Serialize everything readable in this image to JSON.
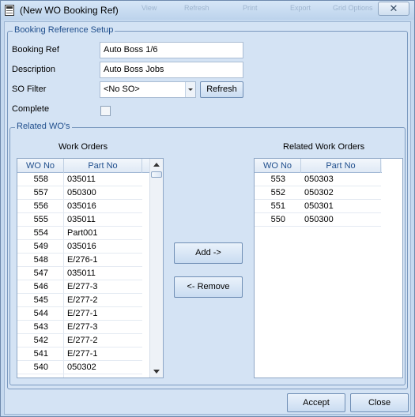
{
  "window": {
    "title": "(New WO Booking Ref)",
    "close_label": "✕",
    "background_toolbar": [
      "View",
      "Refresh",
      "Print",
      "Export",
      "Grid Options"
    ]
  },
  "booking": {
    "legend": "Booking Reference Setup",
    "ref_label": "Booking Ref",
    "ref_value": "Auto Boss 1/6",
    "desc_label": "Description",
    "desc_value": "Auto Boss Jobs",
    "so_label": "SO Filter",
    "so_value": "<No SO>",
    "refresh_label": "Refresh",
    "complete_label": "Complete",
    "complete_checked": false
  },
  "related": {
    "legend": "Related WO's",
    "left_caption": "Work Orders",
    "right_caption": "Related Work Orders",
    "columns": [
      "WO No",
      "Part No"
    ],
    "work_orders": [
      [
        "558",
        "035011"
      ],
      [
        "557",
        "050300"
      ],
      [
        "556",
        "035016"
      ],
      [
        "555",
        "035011"
      ],
      [
        "554",
        "Part001"
      ],
      [
        "549",
        "035016"
      ],
      [
        "548",
        "E/276-1"
      ],
      [
        "547",
        "035011"
      ],
      [
        "546",
        "E/277-3"
      ],
      [
        "545",
        "E/277-2"
      ],
      [
        "544",
        "E/277-1"
      ],
      [
        "543",
        "E/277-3"
      ],
      [
        "542",
        "E/277-2"
      ],
      [
        "541",
        "E/277-1"
      ],
      [
        "540",
        "050302"
      ]
    ],
    "related_orders": [
      [
        "553",
        "050303"
      ],
      [
        "552",
        "050302"
      ],
      [
        "551",
        "050301"
      ],
      [
        "550",
        "050300"
      ]
    ],
    "add_label": "Add ->",
    "remove_label": "<- Remove"
  },
  "footer": {
    "accept_label": "Accept",
    "close_label": "Close"
  }
}
